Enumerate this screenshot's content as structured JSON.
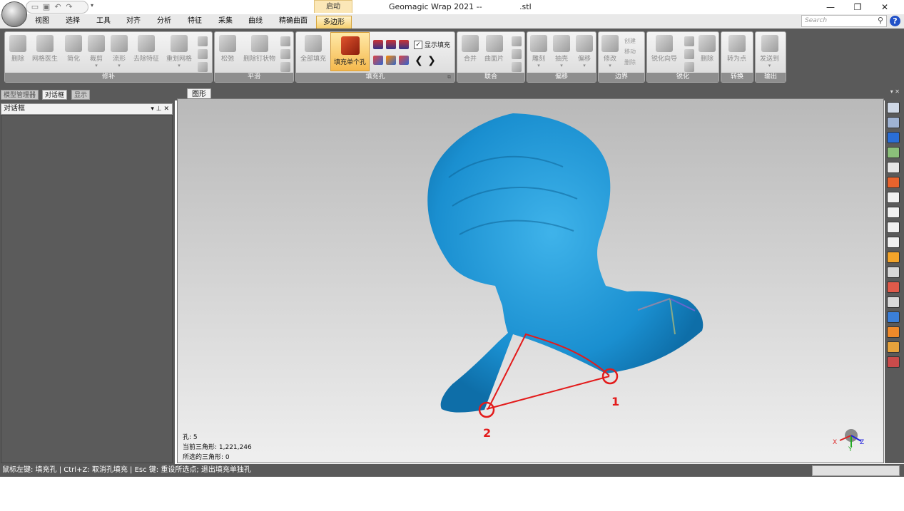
{
  "titlebar": {
    "context_tab": "启动",
    "title": "Geomagic Wrap 2021 --               .stl",
    "controls": [
      "—",
      "❐",
      "✕"
    ]
  },
  "menu": {
    "items": [
      "视图",
      "选择",
      "工具",
      "对齐",
      "分析",
      "特征",
      "采集",
      "曲线",
      "精确曲面"
    ],
    "active": "多边形",
    "search_placeholder": "Search"
  },
  "ribbon": {
    "groups": [
      {
        "label": "修补",
        "buttons": [
          "删除",
          "网格医生",
          "简化",
          "裁剪",
          "流形",
          "去除特征",
          "重划网格"
        ]
      },
      {
        "label": "平滑",
        "buttons": [
          "松弛",
          "删除钉状物"
        ]
      },
      {
        "label": "填充孔",
        "buttons": [
          "全部填充",
          "填充单个孔"
        ],
        "checkbox": "显示填充"
      },
      {
        "label": "联合",
        "buttons": [
          "合并",
          "曲面片"
        ]
      },
      {
        "label": "偏移",
        "buttons": [
          "雕刻",
          "抽壳",
          "偏移"
        ]
      },
      {
        "label": "边界",
        "buttons": [
          "修改"
        ],
        "sub": [
          "创建",
          "移动",
          "删除"
        ]
      },
      {
        "label": "锐化",
        "buttons": [
          "锐化向导",
          "删除"
        ]
      },
      {
        "label": "转换",
        "buttons": [
          "转为点"
        ]
      },
      {
        "label": "输出",
        "buttons": [
          "发送到"
        ]
      }
    ]
  },
  "panel_tabs": [
    "模型管理器",
    "对话框",
    "显示"
  ],
  "view_tab": "图形",
  "dialog_title": "对话框",
  "dialog_ctrls": "▼ 𝟒 ✕",
  "viewport": {
    "info": [
      "孔: 5",
      "当前三角形: 1,221,246",
      "所选的三角形: 0"
    ],
    "annotation_labels": [
      "1",
      "2"
    ],
    "axis_labels": {
      "x": "X",
      "y": "Y",
      "z": "Z"
    }
  },
  "statusbar": {
    "text": "鼠标左键: 填充孔 | Ctrl+Z: 取消孔填充 | Esc 键: 重设所选点; 退出填充单独孔"
  },
  "colors": {
    "model": "#1a8fd0",
    "annotation": "#e31b1b",
    "ribbon_active": "#f5b94d",
    "chrome": "#5a5a5a"
  }
}
